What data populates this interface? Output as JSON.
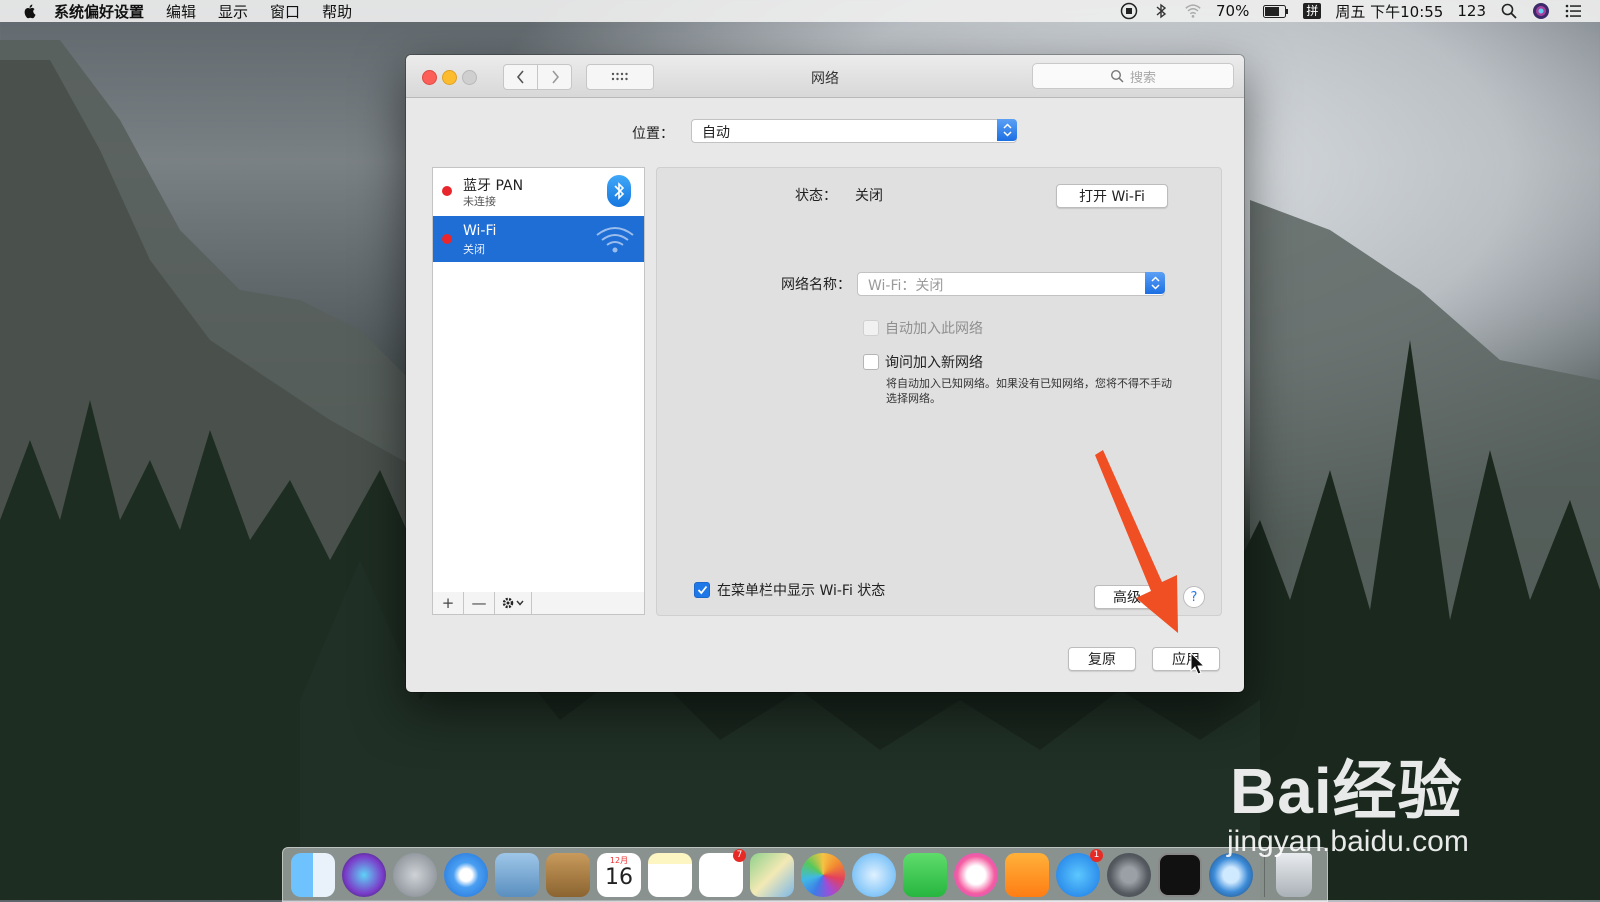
{
  "menubar": {
    "app_name": "系统偏好设置",
    "menus": [
      "编辑",
      "显示",
      "窗口",
      "帮助"
    ],
    "battery": "70%",
    "ime": "拼",
    "datetime": "周五 下午10:55",
    "user": "123"
  },
  "window": {
    "title": "网络",
    "search_placeholder": "搜索",
    "location_label": "位置：",
    "location_value": "自动"
  },
  "services": [
    {
      "name": "蓝牙 PAN",
      "status": "未连接",
      "status_color": "#e8262b",
      "icon": "bluetooth-icon"
    },
    {
      "name": "Wi-Fi",
      "status": "关闭",
      "status_color": "#e8262b",
      "icon": "wifi-icon",
      "selected": true
    }
  ],
  "service_toolbar": {
    "add": "+",
    "remove": "—"
  },
  "detail": {
    "status_label": "状态：",
    "status_value": "关闭",
    "turn_on_button": "打开 Wi-Fi",
    "network_name_label": "网络名称：",
    "network_name_value": "Wi-Fi：关闭",
    "auto_join_label": "自动加入此网络",
    "ask_join_label": "询问加入新网络",
    "ask_join_note": "将自动加入已知网络。如果没有已知网络，您将不得不手动选择网络。",
    "show_status_label": "在菜单栏中显示 Wi-Fi 状态",
    "show_status_checked": true,
    "advanced_button": "高级",
    "help_button": "?"
  },
  "footer": {
    "revert_button": "复原",
    "apply_button": "应用"
  },
  "dock": {
    "calendar_day": "16",
    "calendar_month": "12月",
    "reminders_badge": "7",
    "appstore_badge": "1"
  },
  "watermark": {
    "brand": "Bai经验",
    "url": "jingyan.baidu.com"
  },
  "colors": {
    "accent": "#1f6ed6",
    "annotation_arrow": "#f04e23"
  }
}
